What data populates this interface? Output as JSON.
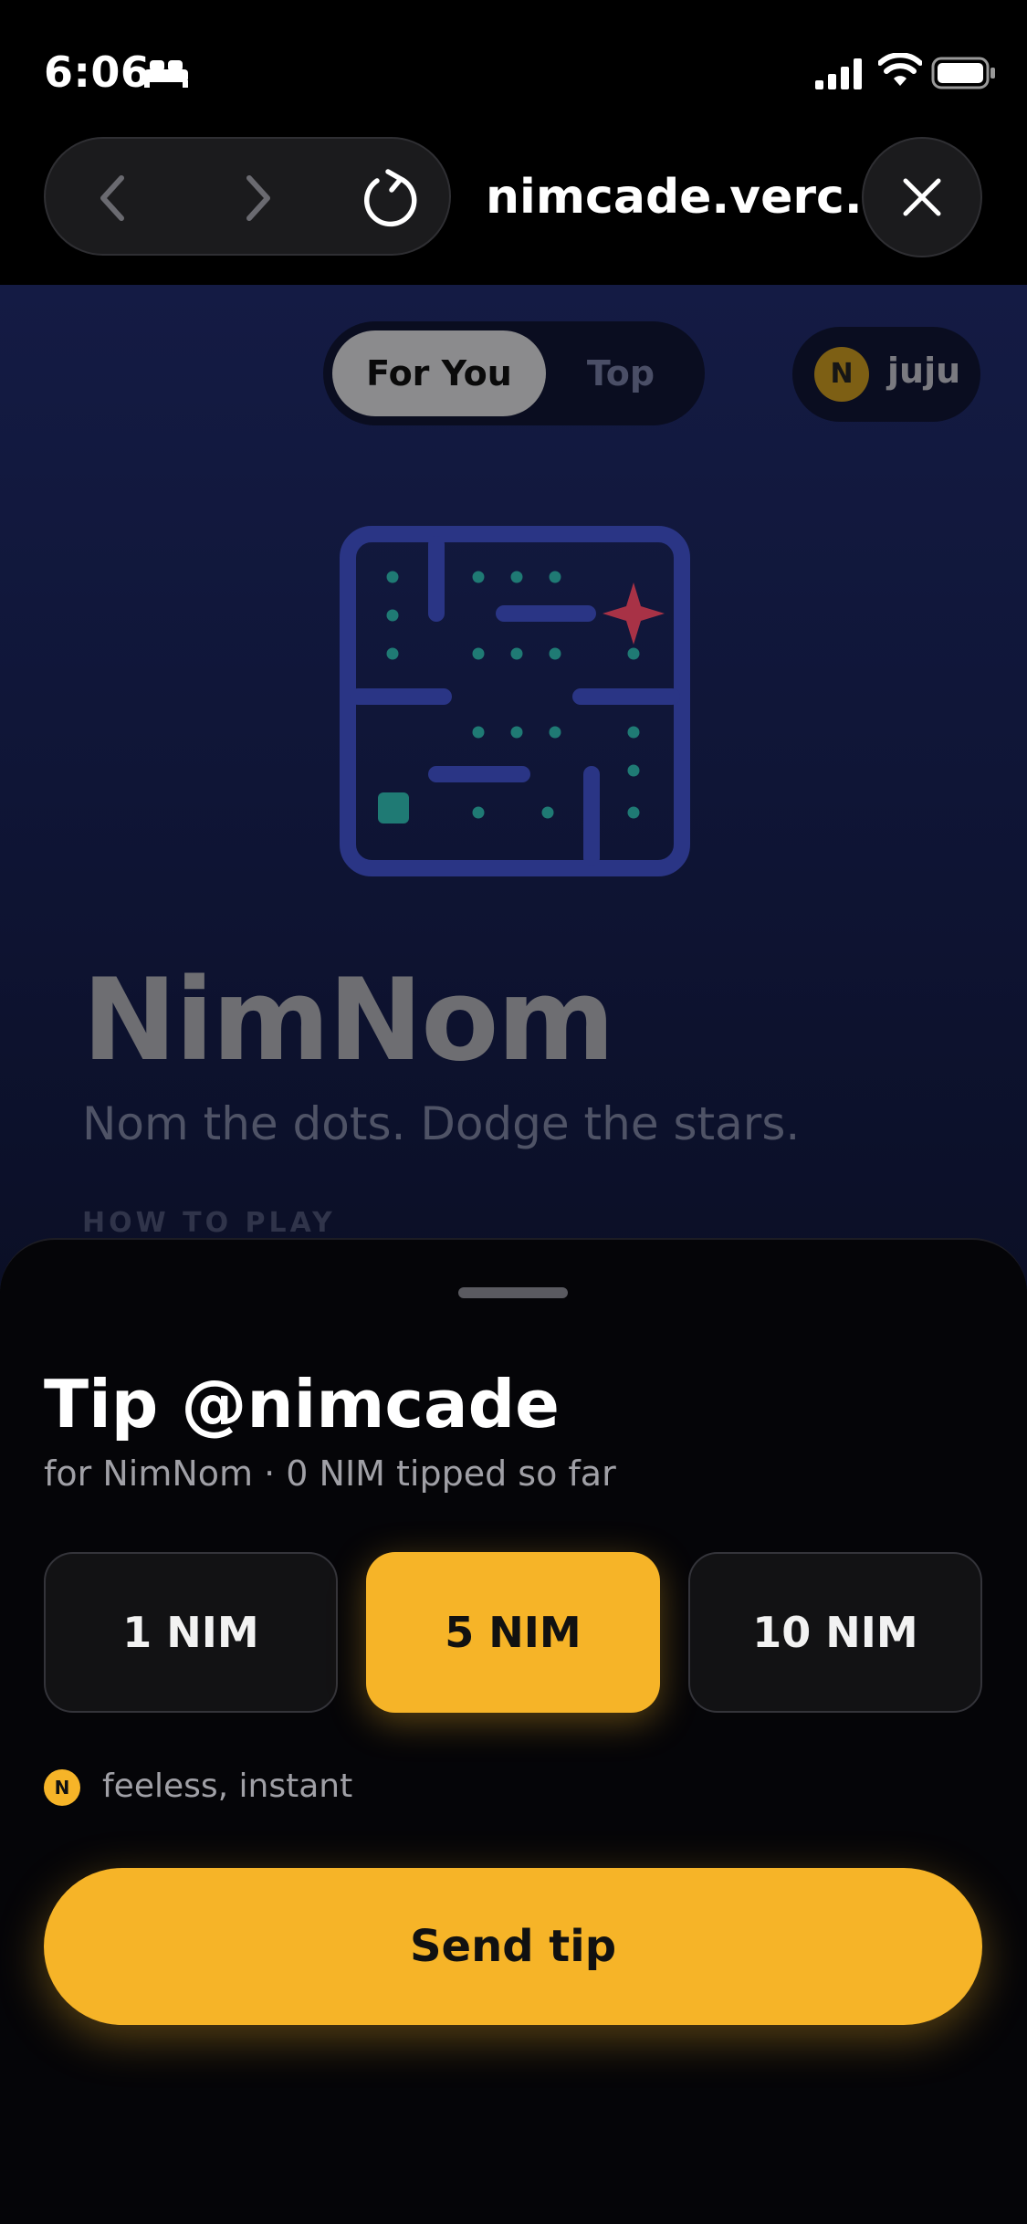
{
  "status_bar": {
    "time": "6:06",
    "icons": [
      "bed-icon",
      "cellular-signal-icon",
      "wifi-icon",
      "battery-icon"
    ]
  },
  "browser": {
    "url": "nimcade.verc...",
    "icons": [
      "back-icon",
      "forward-icon",
      "reload-icon",
      "close-icon"
    ]
  },
  "feed_tabs": {
    "items": [
      {
        "label": "For You",
        "active": true
      },
      {
        "label": "Top",
        "active": false
      }
    ]
  },
  "user": {
    "coin_letter": "N",
    "name": "juju"
  },
  "game": {
    "title": "NimNom",
    "tagline": "Nom the dots. Dodge the stars.",
    "section_heading": "HOW TO PLAY"
  },
  "tip_sheet": {
    "title": "Tip @nimcade",
    "subtitle": "for NimNom · 0 NIM tipped so far",
    "amounts": [
      {
        "label": "1 NIM",
        "selected": false
      },
      {
        "label": "5 NIM",
        "selected": true
      },
      {
        "label": "10 NIM",
        "selected": false
      }
    ],
    "note_coin": "N",
    "note": "feeless, instant",
    "send_label": "Send tip"
  },
  "colors": {
    "accent": "#f6b428",
    "page_bg_top": "#141b44",
    "page_bg_bottom": "#0b0f26",
    "sheet_bg": "#050508",
    "maze_wall": "#2a3585",
    "dot": "#1f7a74",
    "star": "#a83246"
  }
}
